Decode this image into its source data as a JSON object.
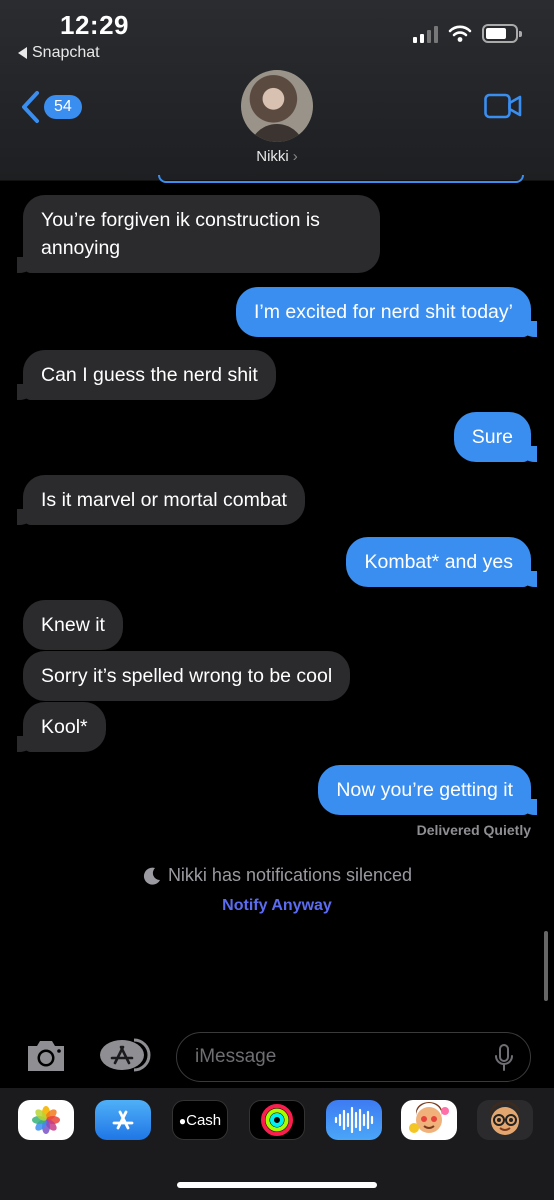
{
  "status_bar": {
    "time": "12:29",
    "back_app": "Snapchat"
  },
  "header": {
    "unread_count": "54",
    "contact_name": "Nikki",
    "chevron": "›"
  },
  "messages": [
    {
      "from": "them",
      "text": "You’re forgiven ik construction is annoying"
    },
    {
      "from": "me",
      "text": "I’m excited for nerd shit today’"
    },
    {
      "from": "them",
      "text": "Can I guess the nerd shit"
    },
    {
      "from": "me",
      "text": "Sure"
    },
    {
      "from": "them",
      "text": "Is it marvel or mortal combat"
    },
    {
      "from": "me",
      "text": "Kombat* and yes"
    },
    {
      "from": "them",
      "text": "Knew it"
    },
    {
      "from": "them",
      "text": "Sorry it’s spelled wrong to be cool"
    },
    {
      "from": "them",
      "text": "Kool*"
    },
    {
      "from": "me",
      "text": "Now you’re getting it"
    }
  ],
  "delivery_status": "Delivered Quietly",
  "focus_notice": {
    "icon": "moon-icon",
    "text": "Nikki has notifications silenced",
    "action": "Notify Anyway"
  },
  "composer": {
    "placeholder": "iMessage"
  },
  "app_drawer": {
    "apps": [
      {
        "name": "Photos",
        "icon": "photos-icon"
      },
      {
        "name": "App Store",
        "icon": "app-store-icon"
      },
      {
        "name": "Cash",
        "icon": "apple-cash-icon",
        "label": "Cash"
      },
      {
        "name": "Fitness",
        "icon": "activity-rings-icon"
      },
      {
        "name": "Audio",
        "icon": "audio-waveform-icon"
      },
      {
        "name": "Memoji Stickers",
        "icon": "memoji-icon"
      },
      {
        "name": "Animoji",
        "icon": "animoji-icon"
      }
    ]
  },
  "colors": {
    "outgoing_bubble": "#3a8ef0",
    "incoming_bubble": "#2b2b2e",
    "link": "#5b6cf0",
    "background": "#000000"
  }
}
